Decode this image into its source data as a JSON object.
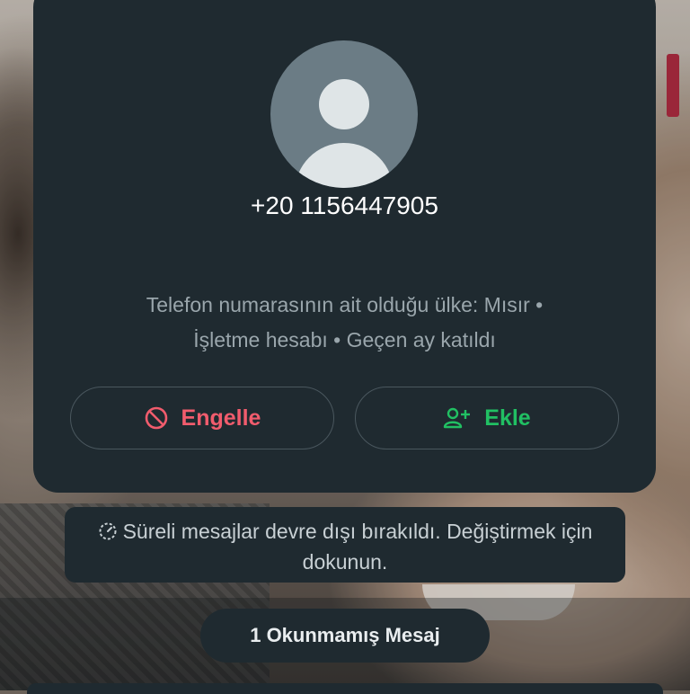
{
  "contact": {
    "phone": "+20 1156447905",
    "info_line1": "Telefon numarasının ait olduğu ülke: Mısır •",
    "info_line2": "İşletme hesabı • Geçen ay katıldı"
  },
  "actions": {
    "block_label": "Engelle",
    "add_label": "Ekle"
  },
  "notice": {
    "icon": "timer-off-icon",
    "text": "Süreli mesajlar devre dışı bırakıldı. Değiştirmek için dokunun."
  },
  "unread": {
    "label": "1 Okunmamış Mesaj"
  },
  "colors": {
    "card_bg": "#1f2a30",
    "block_red": "#f15c6d",
    "add_green": "#21c063",
    "avatar_bg": "#6b7c85"
  }
}
